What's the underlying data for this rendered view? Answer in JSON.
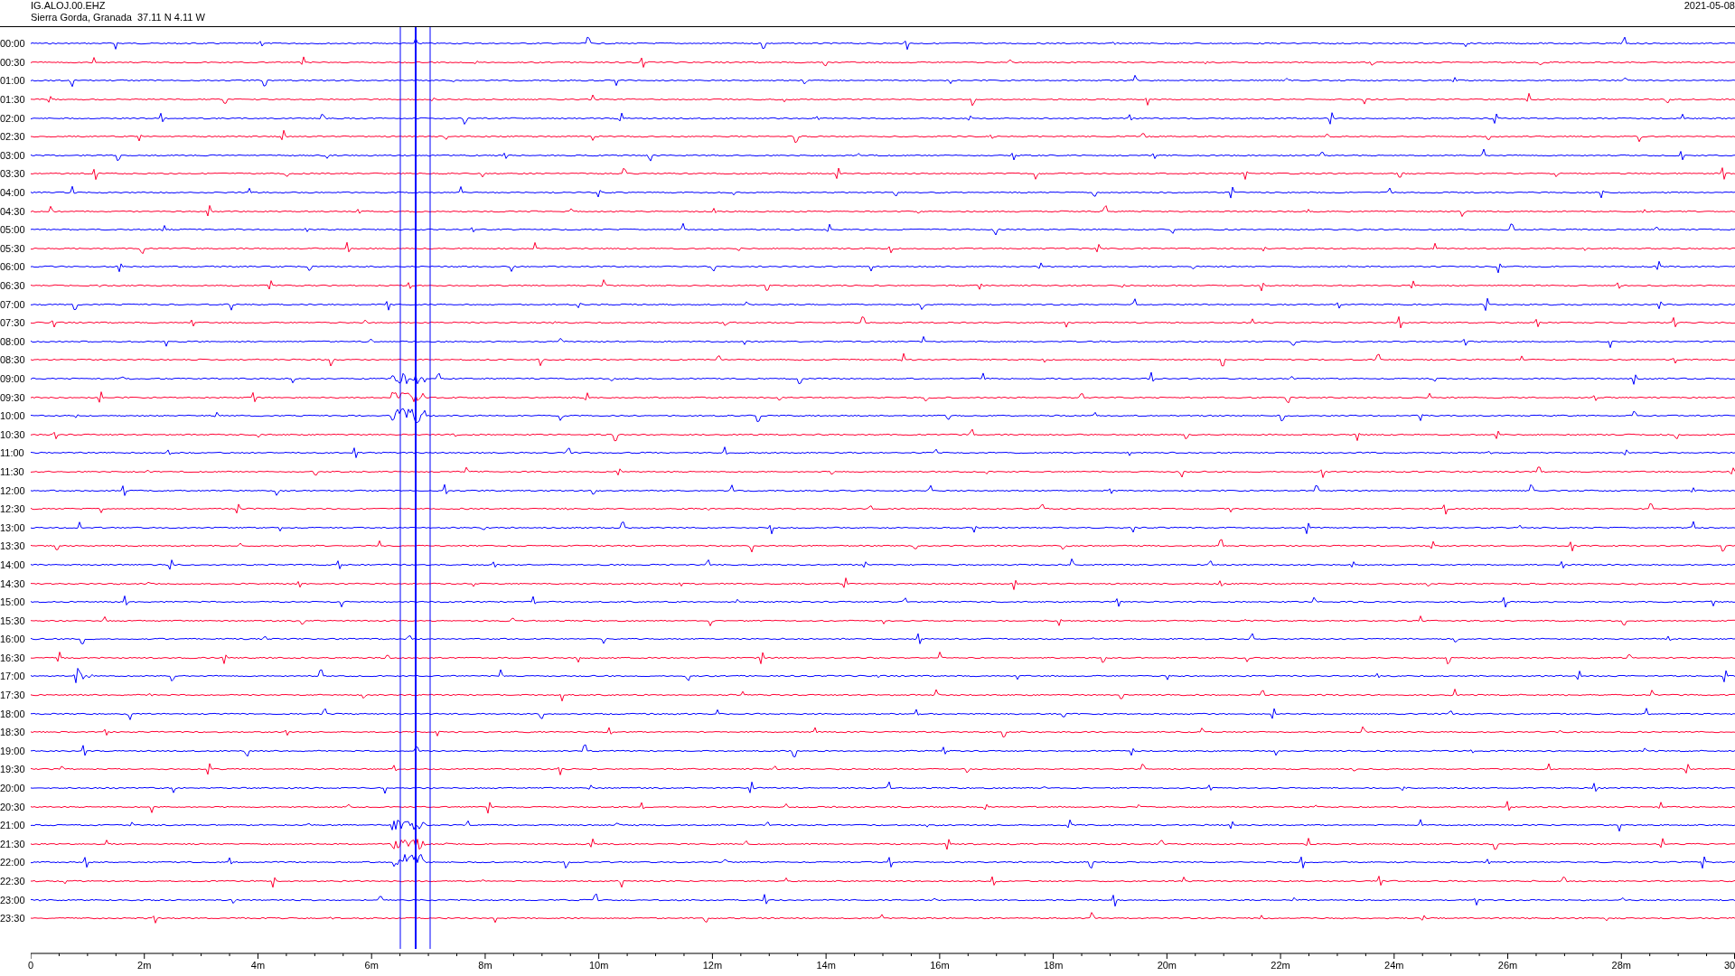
{
  "header": {
    "station": "IG.ALOJ.00.EHZ",
    "location": "Sierra Gorda, Granada  37.11 N 4.11 W",
    "date": "2021-05-08"
  },
  "traces": [
    {
      "label": "00:00",
      "color": "#0000ff"
    },
    {
      "label": "00:30",
      "color": "#ff0033"
    },
    {
      "label": "01:00",
      "color": "#0000ff"
    },
    {
      "label": "01:30",
      "color": "#ff0033"
    },
    {
      "label": "02:00",
      "color": "#0000ff"
    },
    {
      "label": "02:30",
      "color": "#ff0033"
    },
    {
      "label": "03:00",
      "color": "#0000ff"
    },
    {
      "label": "03:30",
      "color": "#ff0033"
    },
    {
      "label": "04:00",
      "color": "#0000ff"
    },
    {
      "label": "04:30",
      "color": "#ff0033"
    },
    {
      "label": "05:00",
      "color": "#0000ff"
    },
    {
      "label": "05:30",
      "color": "#ff0033"
    },
    {
      "label": "06:00",
      "color": "#0000ff"
    },
    {
      "label": "06:30",
      "color": "#ff0033"
    },
    {
      "label": "07:00",
      "color": "#0000ff"
    },
    {
      "label": "07:30",
      "color": "#ff0033"
    },
    {
      "label": "08:00",
      "color": "#0000ff"
    },
    {
      "label": "08:30",
      "color": "#ff0033"
    },
    {
      "label": "09:00",
      "color": "#0000ff"
    },
    {
      "label": "09:30",
      "color": "#ff0033"
    },
    {
      "label": "10:00",
      "color": "#0000ff"
    },
    {
      "label": "10:30",
      "color": "#ff0033"
    },
    {
      "label": "11:00",
      "color": "#0000ff"
    },
    {
      "label": "11:30",
      "color": "#ff0033"
    },
    {
      "label": "12:00",
      "color": "#0000ff"
    },
    {
      "label": "12:30",
      "color": "#ff0033"
    },
    {
      "label": "13:00",
      "color": "#0000ff"
    },
    {
      "label": "13:30",
      "color": "#ff0033"
    },
    {
      "label": "14:00",
      "color": "#0000ff"
    },
    {
      "label": "14:30",
      "color": "#ff0033"
    },
    {
      "label": "15:00",
      "color": "#0000ff"
    },
    {
      "label": "15:30",
      "color": "#ff0033"
    },
    {
      "label": "16:00",
      "color": "#0000ff"
    },
    {
      "label": "16:30",
      "color": "#ff0033"
    },
    {
      "label": "17:00",
      "color": "#0000ff"
    },
    {
      "label": "17:30",
      "color": "#ff0033"
    },
    {
      "label": "18:00",
      "color": "#0000ff"
    },
    {
      "label": "18:30",
      "color": "#ff0033"
    },
    {
      "label": "19:00",
      "color": "#0000ff"
    },
    {
      "label": "19:30",
      "color": "#ff0033"
    },
    {
      "label": "20:00",
      "color": "#0000ff"
    },
    {
      "label": "20:30",
      "color": "#ff0033"
    },
    {
      "label": "21:00",
      "color": "#0000ff"
    },
    {
      "label": "21:30",
      "color": "#ff0033"
    },
    {
      "label": "22:00",
      "color": "#0000ff"
    },
    {
      "label": "22:30",
      "color": "#ff0033"
    },
    {
      "label": "23:00",
      "color": "#0000ff"
    },
    {
      "label": "23:30",
      "color": "#ff0033"
    }
  ],
  "axis": {
    "ticks": [
      "0",
      "2m",
      "4m",
      "6m",
      "8m",
      "10m",
      "12m",
      "14m",
      "16m",
      "18m",
      "20m",
      "22m",
      "24m",
      "26m",
      "28m",
      "30"
    ]
  }
}
